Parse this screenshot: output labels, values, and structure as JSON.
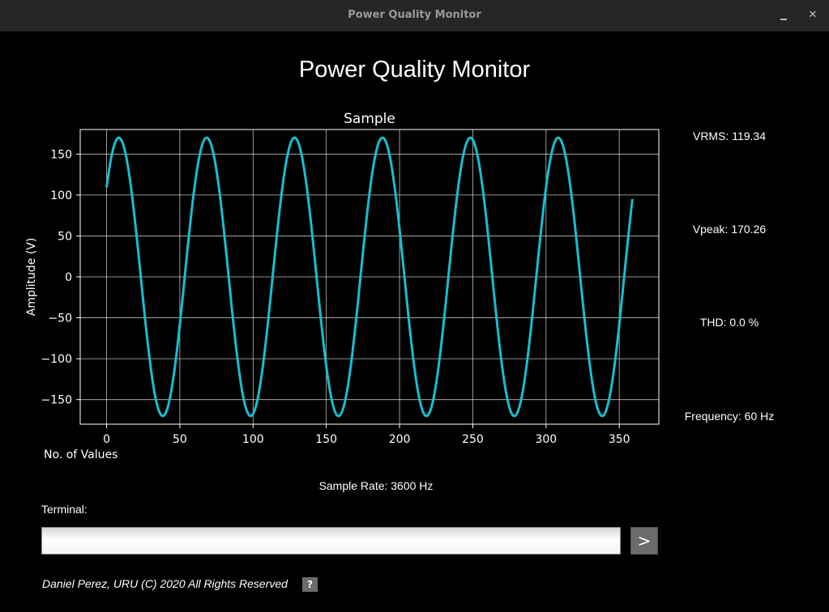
{
  "window": {
    "title": "Power Quality Monitor",
    "minimize_icon": "minimize-icon",
    "close_icon": "close-icon",
    "close_glyph": "✕"
  },
  "app": {
    "heading": "Power Quality Monitor"
  },
  "metrics": {
    "vrms": "VRMS: 119.34",
    "vpeak": "Vpeak: 170.26",
    "thd": "THD: 0.0 %",
    "frequency": "Frequency: 60 Hz"
  },
  "sample_rate": "Sample Rate: 3600 Hz",
  "terminal": {
    "label": "Terminal:",
    "value": "",
    "send_label": ">"
  },
  "footer": {
    "text": "Daniel Perez, URU (C) 2020 All Rights Reserved",
    "help_label": "?"
  },
  "colors": {
    "background": "#000000",
    "line": "#17becf",
    "grid": "#ffffff",
    "text": "#ffffff"
  },
  "chart_data": {
    "type": "line",
    "title": "Sample",
    "xlabel": "No. of Values",
    "ylabel": "Amplitude (V)",
    "xlim": [
      -18,
      377
    ],
    "ylim": [
      -180,
      180
    ],
    "x_ticks": [
      0,
      50,
      100,
      150,
      200,
      250,
      300,
      350
    ],
    "y_ticks": [
      150,
      100,
      50,
      0,
      -50,
      -100,
      -150
    ],
    "x_tick_labels": [
      "0",
      "50",
      "100",
      "150",
      "200",
      "250",
      "300",
      "350"
    ],
    "y_tick_labels": [
      "150",
      "100",
      "50",
      "0",
      "−50",
      "−100",
      "−150"
    ],
    "grid": true,
    "series": [
      {
        "amplitude": 170,
        "frequency_hz": 60,
        "sample_rate_hz": 3600,
        "phase_deg": 40,
        "x_start": 0,
        "x_end": 359
      }
    ]
  }
}
